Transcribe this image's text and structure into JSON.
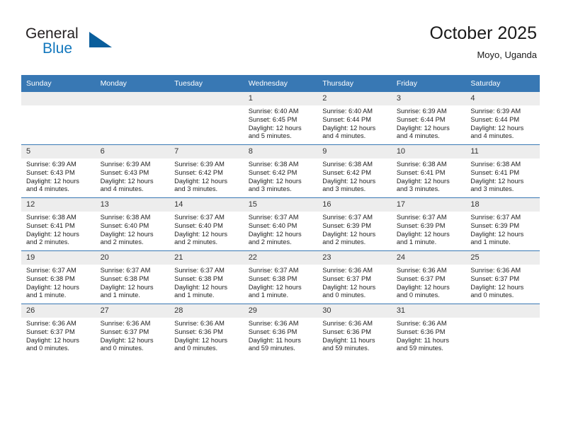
{
  "brand": {
    "name_part1": "General",
    "name_part2": "Blue",
    "triangle_color": "#0a5e9c",
    "blue_color": "#1277bd"
  },
  "header": {
    "title": "October 2025",
    "subtitle": "Moyo, Uganda"
  },
  "theme": {
    "header_row_color": "#3878b4",
    "daynum_band_color": "#ededed",
    "grid_line_color": "#3878b4"
  },
  "weekday_headers": [
    "Sunday",
    "Monday",
    "Tuesday",
    "Wednesday",
    "Thursday",
    "Friday",
    "Saturday"
  ],
  "labels": {
    "sunrise_prefix": "Sunrise:",
    "sunset_prefix": "Sunset:",
    "daylight_prefix": "Daylight:"
  },
  "weeks": [
    [
      {
        "day": "",
        "empty": true
      },
      {
        "day": "",
        "empty": true
      },
      {
        "day": "",
        "empty": true
      },
      {
        "day": "1",
        "sunrise": "Sunrise: 6:40 AM",
        "sunset": "Sunset: 6:45 PM",
        "daylight_line1": "Daylight: 12 hours",
        "daylight_line2": "and 5 minutes."
      },
      {
        "day": "2",
        "sunrise": "Sunrise: 6:40 AM",
        "sunset": "Sunset: 6:44 PM",
        "daylight_line1": "Daylight: 12 hours",
        "daylight_line2": "and 4 minutes."
      },
      {
        "day": "3",
        "sunrise": "Sunrise: 6:39 AM",
        "sunset": "Sunset: 6:44 PM",
        "daylight_line1": "Daylight: 12 hours",
        "daylight_line2": "and 4 minutes."
      },
      {
        "day": "4",
        "sunrise": "Sunrise: 6:39 AM",
        "sunset": "Sunset: 6:44 PM",
        "daylight_line1": "Daylight: 12 hours",
        "daylight_line2": "and 4 minutes."
      }
    ],
    [
      {
        "day": "5",
        "sunrise": "Sunrise: 6:39 AM",
        "sunset": "Sunset: 6:43 PM",
        "daylight_line1": "Daylight: 12 hours",
        "daylight_line2": "and 4 minutes."
      },
      {
        "day": "6",
        "sunrise": "Sunrise: 6:39 AM",
        "sunset": "Sunset: 6:43 PM",
        "daylight_line1": "Daylight: 12 hours",
        "daylight_line2": "and 4 minutes."
      },
      {
        "day": "7",
        "sunrise": "Sunrise: 6:39 AM",
        "sunset": "Sunset: 6:42 PM",
        "daylight_line1": "Daylight: 12 hours",
        "daylight_line2": "and 3 minutes."
      },
      {
        "day": "8",
        "sunrise": "Sunrise: 6:38 AM",
        "sunset": "Sunset: 6:42 PM",
        "daylight_line1": "Daylight: 12 hours",
        "daylight_line2": "and 3 minutes."
      },
      {
        "day": "9",
        "sunrise": "Sunrise: 6:38 AM",
        "sunset": "Sunset: 6:42 PM",
        "daylight_line1": "Daylight: 12 hours",
        "daylight_line2": "and 3 minutes."
      },
      {
        "day": "10",
        "sunrise": "Sunrise: 6:38 AM",
        "sunset": "Sunset: 6:41 PM",
        "daylight_line1": "Daylight: 12 hours",
        "daylight_line2": "and 3 minutes."
      },
      {
        "day": "11",
        "sunrise": "Sunrise: 6:38 AM",
        "sunset": "Sunset: 6:41 PM",
        "daylight_line1": "Daylight: 12 hours",
        "daylight_line2": "and 3 minutes."
      }
    ],
    [
      {
        "day": "12",
        "sunrise": "Sunrise: 6:38 AM",
        "sunset": "Sunset: 6:41 PM",
        "daylight_line1": "Daylight: 12 hours",
        "daylight_line2": "and 2 minutes."
      },
      {
        "day": "13",
        "sunrise": "Sunrise: 6:38 AM",
        "sunset": "Sunset: 6:40 PM",
        "daylight_line1": "Daylight: 12 hours",
        "daylight_line2": "and 2 minutes."
      },
      {
        "day": "14",
        "sunrise": "Sunrise: 6:37 AM",
        "sunset": "Sunset: 6:40 PM",
        "daylight_line1": "Daylight: 12 hours",
        "daylight_line2": "and 2 minutes."
      },
      {
        "day": "15",
        "sunrise": "Sunrise: 6:37 AM",
        "sunset": "Sunset: 6:40 PM",
        "daylight_line1": "Daylight: 12 hours",
        "daylight_line2": "and 2 minutes."
      },
      {
        "day": "16",
        "sunrise": "Sunrise: 6:37 AM",
        "sunset": "Sunset: 6:39 PM",
        "daylight_line1": "Daylight: 12 hours",
        "daylight_line2": "and 2 minutes."
      },
      {
        "day": "17",
        "sunrise": "Sunrise: 6:37 AM",
        "sunset": "Sunset: 6:39 PM",
        "daylight_line1": "Daylight: 12 hours",
        "daylight_line2": "and 1 minute."
      },
      {
        "day": "18",
        "sunrise": "Sunrise: 6:37 AM",
        "sunset": "Sunset: 6:39 PM",
        "daylight_line1": "Daylight: 12 hours",
        "daylight_line2": "and 1 minute."
      }
    ],
    [
      {
        "day": "19",
        "sunrise": "Sunrise: 6:37 AM",
        "sunset": "Sunset: 6:38 PM",
        "daylight_line1": "Daylight: 12 hours",
        "daylight_line2": "and 1 minute."
      },
      {
        "day": "20",
        "sunrise": "Sunrise: 6:37 AM",
        "sunset": "Sunset: 6:38 PM",
        "daylight_line1": "Daylight: 12 hours",
        "daylight_line2": "and 1 minute."
      },
      {
        "day": "21",
        "sunrise": "Sunrise: 6:37 AM",
        "sunset": "Sunset: 6:38 PM",
        "daylight_line1": "Daylight: 12 hours",
        "daylight_line2": "and 1 minute."
      },
      {
        "day": "22",
        "sunrise": "Sunrise: 6:37 AM",
        "sunset": "Sunset: 6:38 PM",
        "daylight_line1": "Daylight: 12 hours",
        "daylight_line2": "and 1 minute."
      },
      {
        "day": "23",
        "sunrise": "Sunrise: 6:36 AM",
        "sunset": "Sunset: 6:37 PM",
        "daylight_line1": "Daylight: 12 hours",
        "daylight_line2": "and 0 minutes."
      },
      {
        "day": "24",
        "sunrise": "Sunrise: 6:36 AM",
        "sunset": "Sunset: 6:37 PM",
        "daylight_line1": "Daylight: 12 hours",
        "daylight_line2": "and 0 minutes."
      },
      {
        "day": "25",
        "sunrise": "Sunrise: 6:36 AM",
        "sunset": "Sunset: 6:37 PM",
        "daylight_line1": "Daylight: 12 hours",
        "daylight_line2": "and 0 minutes."
      }
    ],
    [
      {
        "day": "26",
        "sunrise": "Sunrise: 6:36 AM",
        "sunset": "Sunset: 6:37 PM",
        "daylight_line1": "Daylight: 12 hours",
        "daylight_line2": "and 0 minutes."
      },
      {
        "day": "27",
        "sunrise": "Sunrise: 6:36 AM",
        "sunset": "Sunset: 6:37 PM",
        "daylight_line1": "Daylight: 12 hours",
        "daylight_line2": "and 0 minutes."
      },
      {
        "day": "28",
        "sunrise": "Sunrise: 6:36 AM",
        "sunset": "Sunset: 6:36 PM",
        "daylight_line1": "Daylight: 12 hours",
        "daylight_line2": "and 0 minutes."
      },
      {
        "day": "29",
        "sunrise": "Sunrise: 6:36 AM",
        "sunset": "Sunset: 6:36 PM",
        "daylight_line1": "Daylight: 11 hours",
        "daylight_line2": "and 59 minutes."
      },
      {
        "day": "30",
        "sunrise": "Sunrise: 6:36 AM",
        "sunset": "Sunset: 6:36 PM",
        "daylight_line1": "Daylight: 11 hours",
        "daylight_line2": "and 59 minutes."
      },
      {
        "day": "31",
        "sunrise": "Sunrise: 6:36 AM",
        "sunset": "Sunset: 6:36 PM",
        "daylight_line1": "Daylight: 11 hours",
        "daylight_line2": "and 59 minutes."
      },
      {
        "day": "",
        "empty": true
      }
    ]
  ]
}
